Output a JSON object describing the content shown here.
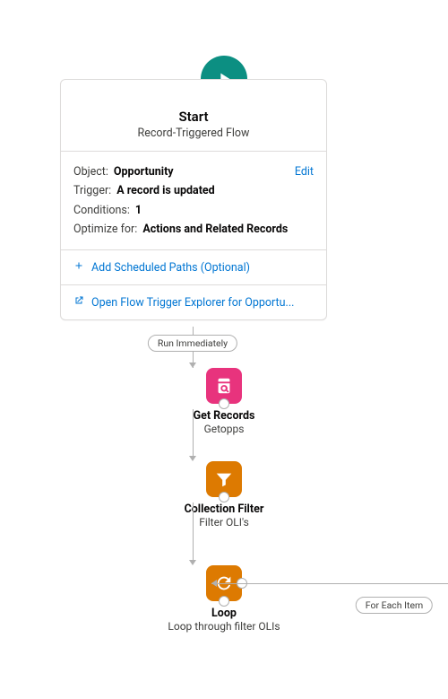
{
  "start": {
    "title": "Start",
    "subtitle": "Record-Triggered Flow",
    "object_label": "Object:",
    "object_value": "Opportunity",
    "edit": "Edit",
    "trigger_label": "Trigger:",
    "trigger_value": "A record is updated",
    "conditions_label": "Conditions:",
    "conditions_value": "1",
    "optimize_label": "Optimize for:",
    "optimize_value": "Actions and Related Records",
    "add_scheduled": "Add Scheduled Paths (Optional)",
    "open_explorer": "Open Flow Trigger Explorer for Opportu..."
  },
  "path": {
    "run_badge": "Run Immediately",
    "for_each_badge": "For Each Item"
  },
  "nodes": {
    "get_records": {
      "type": "Get Records",
      "label": "Getopps"
    },
    "collection_filter": {
      "type": "Collection Filter",
      "label": "Filter OLI's"
    },
    "loop": {
      "type": "Loop",
      "label": "Loop through filter OLIs"
    }
  }
}
